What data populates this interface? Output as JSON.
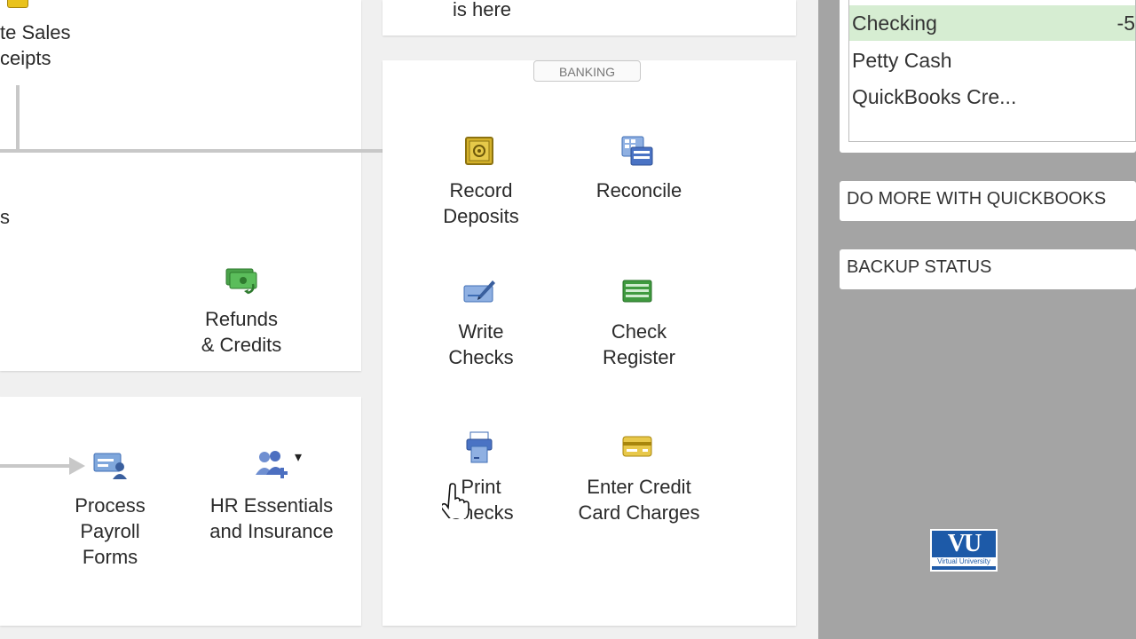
{
  "customers": {
    "sales_receipts_label_l1": "te Sales",
    "sales_receipts_label_l2": "ceipts",
    "partial_label": "s",
    "refunds_label_l1": "Refunds",
    "refunds_label_l2": "& Credits"
  },
  "employees": {
    "payroll_forms_l1": "Process",
    "payroll_forms_l2": "Payroll",
    "payroll_forms_l3": "Forms",
    "hr_l1": "HR Essentials",
    "hr_l2": "and Insurance",
    "hr_dropdown": "▾"
  },
  "top_panel": {
    "partial_text": "is here"
  },
  "banking": {
    "tab_label": "BANKING",
    "record_deposits_l1": "Record",
    "record_deposits_l2": "Deposits",
    "reconcile": "Reconcile",
    "write_checks_l1": "Write",
    "write_checks_l2": "Checks",
    "check_register_l1": "Check",
    "check_register_l2": "Register",
    "print_checks_l1": "Print",
    "print_checks_l2": "Checks",
    "credit_charges_l1": "Enter Credit",
    "credit_charges_l2": "Card Charges"
  },
  "accounts": {
    "rows": [
      {
        "name": "Checking",
        "balance": "-5"
      },
      {
        "name": "Petty Cash"
      },
      {
        "name": "QuickBooks Cre..."
      }
    ]
  },
  "sidebar": {
    "do_more": "DO MORE WITH QUICKBOOKS",
    "backup_status": "BACKUP STATUS"
  },
  "watermark": {
    "logo_text": "VU",
    "logo_subtext": "Virtual University"
  },
  "colors": {
    "selected_row": "#d6edd2",
    "sidebar_bg": "#a4a4a4",
    "flow_arrow": "#c8c8c8",
    "vu_blue": "#1d5aa8"
  }
}
